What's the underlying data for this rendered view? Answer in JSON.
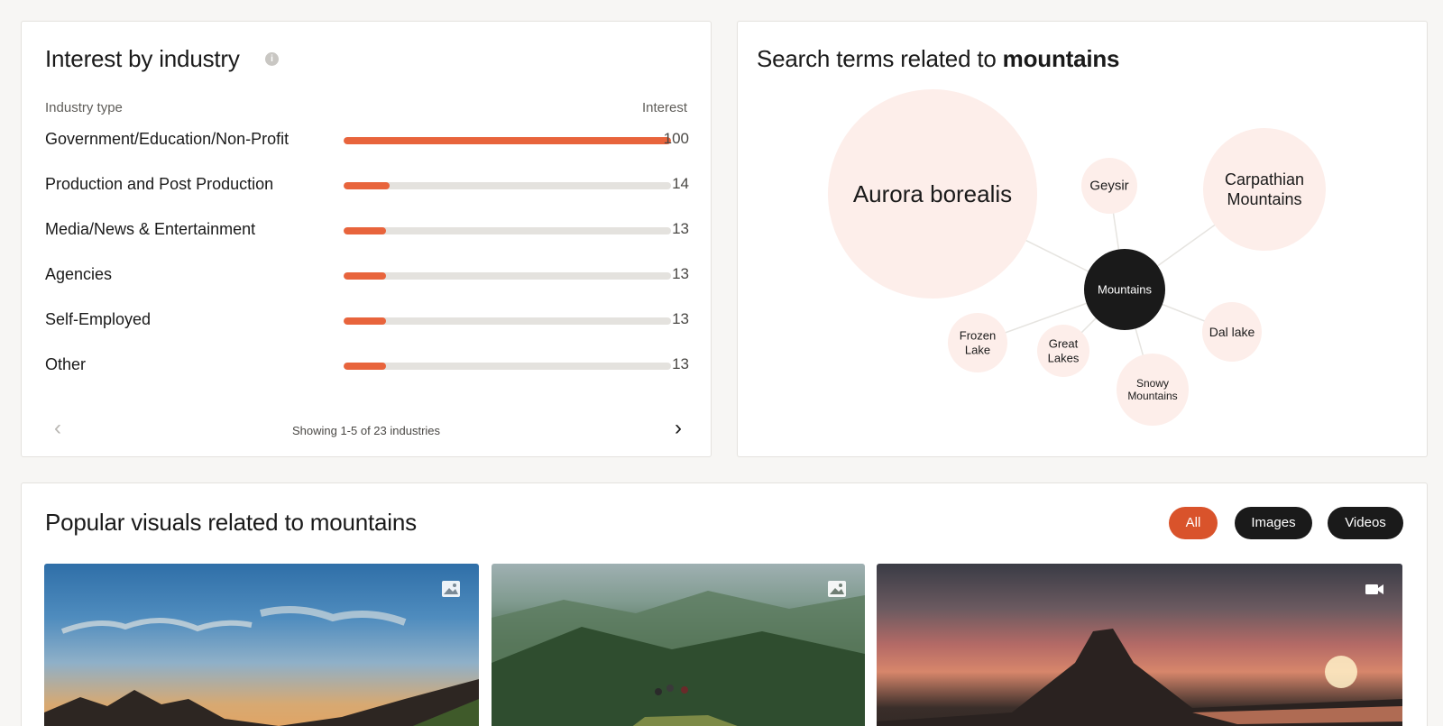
{
  "industry": {
    "title": "Interest by industry",
    "info_icon": "info-icon",
    "col_left": "Industry type",
    "col_right": "Interest",
    "rows": [
      {
        "label": "Government/Education/Non-Profit",
        "value": "100",
        "fill": 1.0
      },
      {
        "label": "Production and Post Production",
        "value": "14",
        "fill": 0.14
      },
      {
        "label": "Media/News & Entertainment",
        "value": "13",
        "fill": 0.13
      },
      {
        "label": "Agencies",
        "value": "13",
        "fill": 0.13
      },
      {
        "label": "Self-Employed",
        "value": "13",
        "fill": 0.13
      },
      {
        "label": "Other",
        "value": "13",
        "fill": 0.13
      }
    ],
    "pager_text": "Showing 1-5 of 23 industries",
    "prev_icon": "chevron-left-icon",
    "next_icon": "chevron-right-icon"
  },
  "terms": {
    "title_prefix": "Search terms related to ",
    "title_term": "mountains",
    "center": "Mountains",
    "bubbles": [
      {
        "name": "aurora",
        "lines": [
          "Aurora borealis"
        ]
      },
      {
        "name": "geysir",
        "lines": [
          "Geysir"
        ]
      },
      {
        "name": "carpathian",
        "lines": [
          "Carpathian",
          "Mountains"
        ]
      },
      {
        "name": "dal-lake",
        "lines": [
          "Dal lake"
        ]
      },
      {
        "name": "snowy",
        "lines": [
          "Snowy",
          "Mountains"
        ]
      },
      {
        "name": "great-lakes",
        "lines": [
          "Great",
          "Lakes"
        ]
      },
      {
        "name": "frozen-lake",
        "lines": [
          "Frozen",
          "Lake"
        ]
      }
    ],
    "colors": {
      "bubble": "#fdeeea",
      "center": "#1a1a1a",
      "line": "#e6e4e0"
    }
  },
  "visuals": {
    "title": "Popular visuals related to mountains",
    "filters": {
      "all": "All",
      "images": "Images",
      "videos": "Videos"
    },
    "active_filter": "All",
    "tiles": [
      {
        "type": "image",
        "badge_icon": "image-icon"
      },
      {
        "type": "image",
        "badge_icon": "image-icon"
      },
      {
        "type": "video",
        "badge_icon": "video-camera-icon"
      }
    ]
  },
  "colors": {
    "accent": "#e8643c",
    "active_filter": "#d9532b",
    "dark": "#1a1a1a"
  }
}
